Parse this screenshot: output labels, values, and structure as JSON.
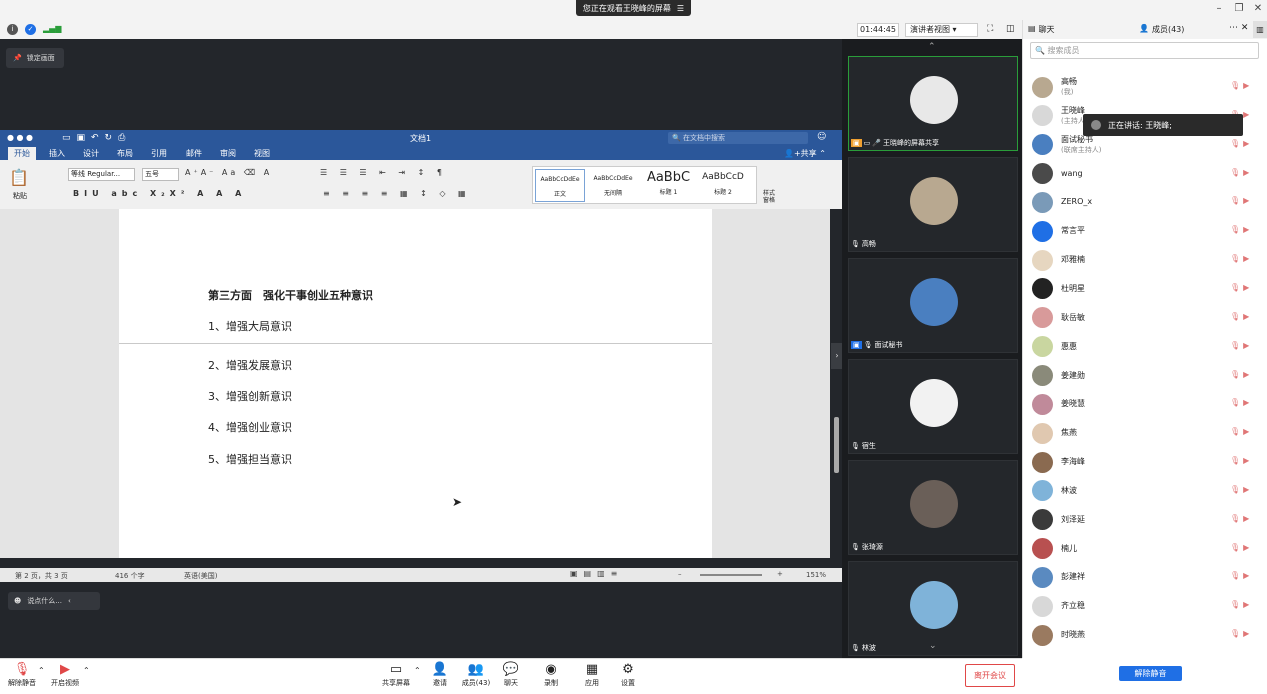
{
  "top": {
    "watching": "您正在观看王晓峰的屏幕",
    "timer": "01:44:45",
    "presenter_view": "演讲者视图",
    "chat_tab": "聊天",
    "members_tab": "成员(43)"
  },
  "share": {
    "lock": "锁定画面",
    "chat_prompt": "说点什么..."
  },
  "word": {
    "doc_title": "文档1",
    "search_placeholder": "在文档中搜索",
    "tabs": [
      "开始",
      "插入",
      "设计",
      "布局",
      "引用",
      "邮件",
      "审阅",
      "视图"
    ],
    "share_btn": "共享",
    "paste": "粘贴",
    "font_name": "等线 Regular...",
    "font_size": "五号",
    "styles": [
      {
        "sample": "AaBbCcDdEe",
        "name": "正文"
      },
      {
        "sample": "AaBbCcDdEe",
        "name": "无间隔"
      },
      {
        "sample": "AaBbC",
        "name": "标题 1"
      },
      {
        "sample": "AaBbCcD",
        "name": "标题 2"
      }
    ],
    "styles_pane": "样式\n窗格",
    "doc_heading": "第三方面　强化干事创业五种意识",
    "doc_lines": [
      "1、增强大局意识",
      "2、增强发展意识",
      "3、增强创新意识",
      "4、增强创业意识",
      "5、增强担当意识"
    ],
    "status": {
      "page": "第 2 页，共 3 页",
      "words": "416 个字",
      "lang": "英语(美国)",
      "zoom": "151%"
    }
  },
  "videos": [
    {
      "name": "王晓峰的屏幕共享",
      "color": "#e8e8e8"
    },
    {
      "name": "高畅",
      "color": "#b8a890"
    },
    {
      "name": "面试秘书",
      "color": "#4a7fc0"
    },
    {
      "name": "宿生",
      "color": "#f2f2f2"
    },
    {
      "name": "张琦源",
      "color": "#6a5f58"
    },
    {
      "name": "林波",
      "color": "#7fb3d9"
    }
  ],
  "panel": {
    "search_placeholder": "搜索成员",
    "speaking": "正在讲话: 王晓峰;",
    "members": [
      {
        "name": "高畅",
        "sub": "(我)",
        "color": "#b8a890"
      },
      {
        "name": "王晓峰",
        "sub": "(主持人)",
        "color": "#d8d8d8"
      },
      {
        "name": "面试秘书",
        "sub": "(联席主持人)",
        "color": "#4a7fc0"
      },
      {
        "name": "wang",
        "sub": "",
        "color": "#4a4a4a"
      },
      {
        "name": "ZERO_x",
        "sub": "",
        "color": "#7a9ab8"
      },
      {
        "name": "常言平",
        "sub": "",
        "color": "#1f6fe5"
      },
      {
        "name": "邓雅楠",
        "sub": "",
        "color": "#e6d6c0"
      },
      {
        "name": "杜明星",
        "sub": "",
        "color": "#222222"
      },
      {
        "name": "耿岳敏",
        "sub": "",
        "color": "#d89a9a"
      },
      {
        "name": "惠惠",
        "sub": "",
        "color": "#c9d6a0"
      },
      {
        "name": "姜建勋",
        "sub": "",
        "color": "#8a8a7a"
      },
      {
        "name": "姜晓慧",
        "sub": "",
        "color": "#c08a9a"
      },
      {
        "name": "焦燕",
        "sub": "",
        "color": "#e0c8b0"
      },
      {
        "name": "李海峰",
        "sub": "",
        "color": "#8a6a50"
      },
      {
        "name": "林波",
        "sub": "",
        "color": "#7fb3d9"
      },
      {
        "name": "刘泽延",
        "sub": "",
        "color": "#3a3a3a"
      },
      {
        "name": "楠儿",
        "sub": "",
        "color": "#b85050"
      },
      {
        "name": "彭建祥",
        "sub": "",
        "color": "#5a8ac0"
      },
      {
        "name": "齐立稳",
        "sub": "",
        "color": "#d8d8d8"
      },
      {
        "name": "时晓燕",
        "sub": "",
        "color": "#9a7a60"
      }
    ],
    "unmute_all": "解除静音"
  },
  "toolbar": {
    "unmute": "解除静音",
    "video": "开启视频",
    "share": "共享屏幕",
    "invite": "邀请",
    "members": "成员(43)",
    "chat": "聊天",
    "record": "录制",
    "apps": "应用",
    "settings": "设置",
    "leave": "离开会议"
  }
}
